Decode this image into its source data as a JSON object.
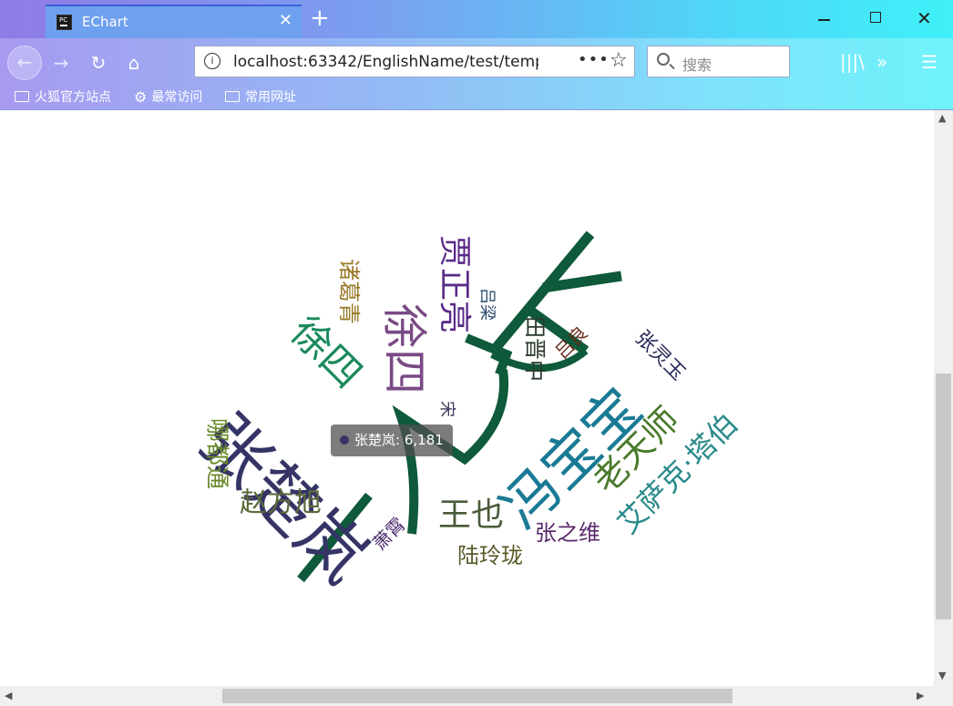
{
  "browser": {
    "tab_title": "EChart",
    "url": "localhost:63342/EnglishName/test/temp",
    "search_placeholder": "搜索",
    "bookmarks": [
      "火狐官方站点",
      "最常访问",
      "常用网址"
    ]
  },
  "chart_data": {
    "type": "wordcloud",
    "words": [
      {
        "name": "张楚岚",
        "value": 6181,
        "color": "#343466"
      },
      {
        "name": "冯宝宝",
        "color": "#1a7a95"
      },
      {
        "name": "徐四",
        "color": "#7a4a85"
      },
      {
        "name": "徐四",
        "color": "#1a8a5a"
      },
      {
        "name": "贾正亮",
        "color": "#5a2a8a"
      },
      {
        "name": "老天师",
        "color": "#4a7a2a"
      },
      {
        "name": "艾萨克·塔伯",
        "color": "#2a8a8a"
      },
      {
        "name": "王也",
        "color": "#4a5a3a"
      },
      {
        "name": "赵方旭",
        "color": "#5a6a3a"
      },
      {
        "name": "诸葛青",
        "color": "#9a7a2a"
      },
      {
        "name": "哪都通",
        "color": "#6a8a2a"
      },
      {
        "name": "田晋中",
        "color": "#2a3a2a"
      },
      {
        "name": "张灵玉",
        "color": "#2a2a5a"
      },
      {
        "name": "吕良",
        "color": "#6a2a1a"
      },
      {
        "name": "陆玲珑",
        "color": "#5a5a2a"
      },
      {
        "name": "张之维",
        "color": "#5a2a6a"
      },
      {
        "name": "萧霄",
        "color": "#4a2a6a"
      },
      {
        "name": "吕梁",
        "color": "#2a4a6a"
      },
      {
        "name": "宋",
        "color": "#3a3a5a"
      }
    ],
    "tooltip": {
      "name": "张楚岚",
      "value": "6,181",
      "color": "#343466"
    }
  }
}
